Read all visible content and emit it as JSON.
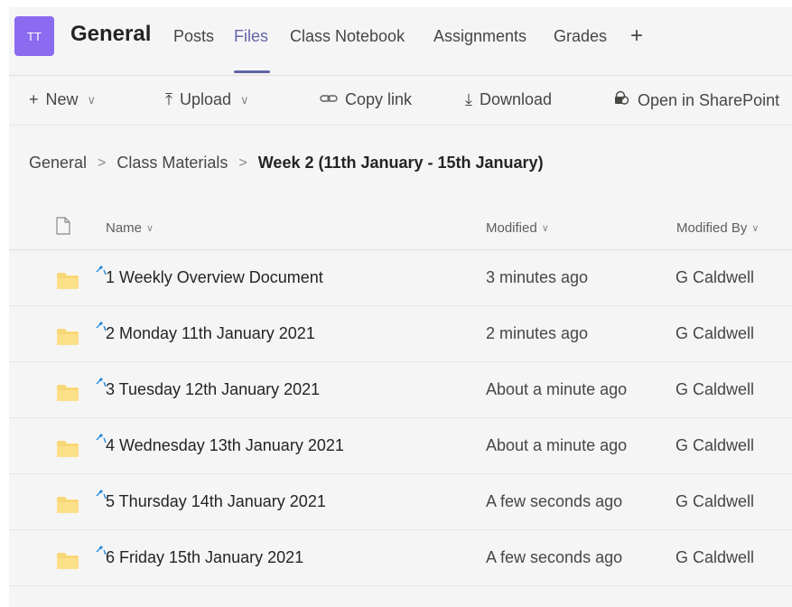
{
  "team": {
    "avatar_initials": "TT",
    "title": "General",
    "avatar_color": "#8b6bf0"
  },
  "tabs": [
    {
      "label": "Posts"
    },
    {
      "label": "Files",
      "active": true
    },
    {
      "label": "Class Notebook"
    },
    {
      "label": "Assignments"
    },
    {
      "label": "Grades"
    }
  ],
  "add_tab_icon": "plus-icon",
  "toolbar": {
    "new_label": "New",
    "upload_label": "Upload",
    "copy_link_label": "Copy link",
    "download_label": "Download",
    "sharepoint_label": "Open in SharePoint"
  },
  "breadcrumb": {
    "items": [
      "General",
      "Class Materials"
    ],
    "current": "Week 2 (11th January - 15th January)"
  },
  "columns": {
    "name": "Name",
    "modified": "Modified",
    "modified_by": "Modified By"
  },
  "files": [
    {
      "name": "1 Weekly Overview Document",
      "modified": "3 minutes ago",
      "modified_by": "G Caldwell"
    },
    {
      "name": "2 Monday 11th January 2021",
      "modified": "2 minutes ago",
      "modified_by": "G Caldwell"
    },
    {
      "name": "3 Tuesday 12th January 2021",
      "modified": "About a minute ago",
      "modified_by": "G Caldwell"
    },
    {
      "name": "4 Wednesday 13th January 2021",
      "modified": "About a minute ago",
      "modified_by": "G Caldwell"
    },
    {
      "name": "5 Thursday 14th January 2021",
      "modified": "A few seconds ago",
      "modified_by": "G Caldwell"
    },
    {
      "name": "6 Friday 15th January 2021",
      "modified": "A few seconds ago",
      "modified_by": "G Caldwell"
    }
  ],
  "colors": {
    "accent": "#6264a7",
    "folder": "#f8d775",
    "sync": "#0078d4"
  }
}
